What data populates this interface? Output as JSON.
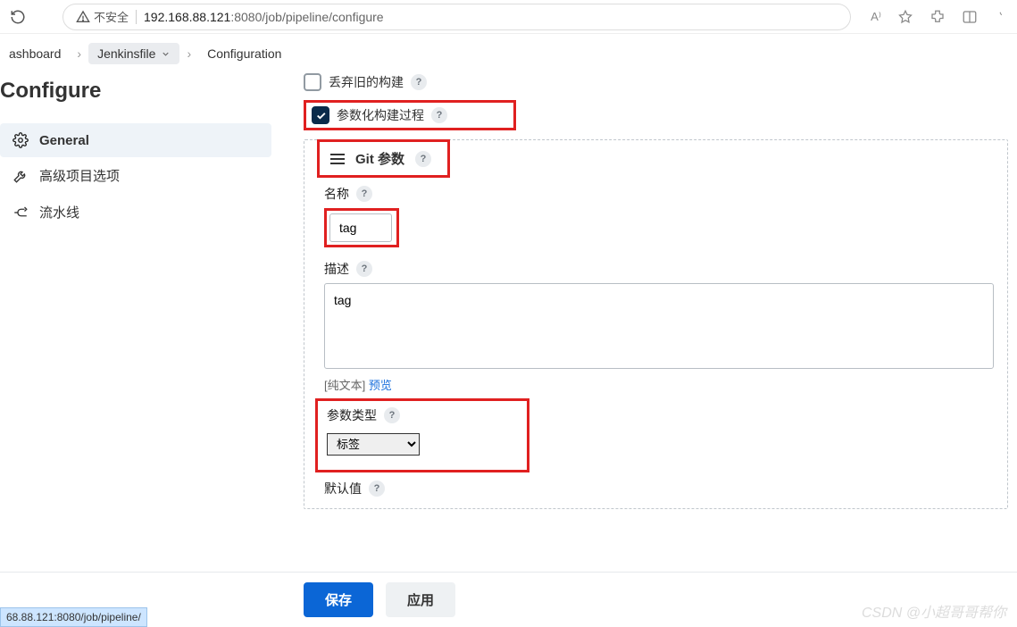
{
  "browser": {
    "insecure_label": "不安全",
    "url_host": "192.168.88.121",
    "url_port": ":8080",
    "url_path": "/job/pipeline/configure",
    "aa_label": "A⁾"
  },
  "breadcrumbs": {
    "items": [
      {
        "label": "ashboard"
      },
      {
        "label": "Jenkinsfile"
      },
      {
        "label": "Configuration"
      }
    ]
  },
  "page_title": "Configure",
  "sidebar": {
    "items": [
      {
        "label": "General"
      },
      {
        "label": "高级项目选项"
      },
      {
        "label": "流水线"
      }
    ]
  },
  "form": {
    "discard_label": "丢弃旧的构建",
    "param_build_label": "参数化构建过程",
    "git_header": "Git 参数",
    "name_label": "名称",
    "name_value": "tag",
    "desc_label": "描述",
    "desc_value": "tag",
    "plaintext_prefix": "[纯文本] ",
    "preview_link": "预览",
    "type_label": "参数类型",
    "type_value": "标签",
    "type_options": [
      "标签"
    ],
    "default_label": "默认值"
  },
  "footer": {
    "save": "保存",
    "apply": "应用"
  },
  "status_url": "68.88.121:8080/job/pipeline/",
  "watermark": "CSDN @小超哥哥帮你"
}
